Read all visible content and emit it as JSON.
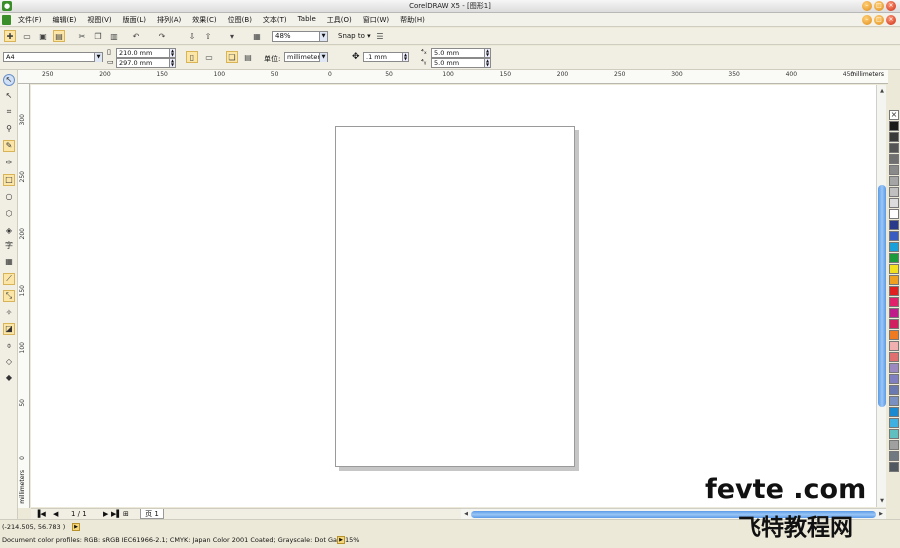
{
  "window": {
    "title": "CorelDRAW X5 - [图形1]"
  },
  "menus": [
    "文件(F)",
    "编辑(E)",
    "视图(V)",
    "版面(L)",
    "排列(A)",
    "效果(C)",
    "位图(B)",
    "文本(T)",
    "Table",
    "工具(O)",
    "窗口(W)",
    "帮助(H)"
  ],
  "toolbar": {
    "zoom_value": "48%",
    "snap_label": "Snap to"
  },
  "property_bar": {
    "page_size": "A4",
    "width": "210.0 mm",
    "height": "297.0 mm",
    "unit_label": "单位:",
    "unit_value": "millimeters",
    "nudge": ".1 mm",
    "dup_x": "5.0 mm",
    "dup_y": "5.0 mm"
  },
  "ruler": {
    "h_labels": [
      "250",
      "200",
      "150",
      "100",
      "50",
      "0",
      "50",
      "100",
      "150",
      "200",
      "250",
      "300",
      "350",
      "400",
      "450"
    ],
    "h_unit": "millimeters",
    "v_labels": [
      "300",
      "250",
      "200",
      "150",
      "100",
      "50",
      "0"
    ],
    "v_unit": "millimeters"
  },
  "page_nav": {
    "counter": "1 / 1",
    "page_tab": "页 1"
  },
  "status": {
    "coords": "(-214.505, 56.783 )",
    "color_profile": "Document color profiles: RGB: sRGB IEC61966-2.1; CMYK: Japan Color 2001 Coated; Grayscale: Dot Gain 15%"
  },
  "palette": {
    "colors": [
      "#1a1a1a",
      "#3a3a3a",
      "#555555",
      "#707070",
      "#8a8a8a",
      "#a5a5a5",
      "#c0c0c0",
      "#dcdcdc",
      "#ffffff",
      "#2a3a8a",
      "#3a5cc0",
      "#1aa0d8",
      "#1a9a3a",
      "#f0e020",
      "#f0a020",
      "#e02020",
      "#e0206a",
      "#c01a8a",
      "#d02060",
      "#f07a20",
      "#f0b0b0",
      "#e07070",
      "#9a8ac0",
      "#8080c0",
      "#6a7ab0",
      "#7a90c0",
      "#1a8ad0",
      "#40b0e0",
      "#60c0c0",
      "#a0a0a0",
      "#707a80",
      "#505860"
    ]
  },
  "watermark": {
    "line1": "fevte .com",
    "line2": "飞特教程网"
  }
}
